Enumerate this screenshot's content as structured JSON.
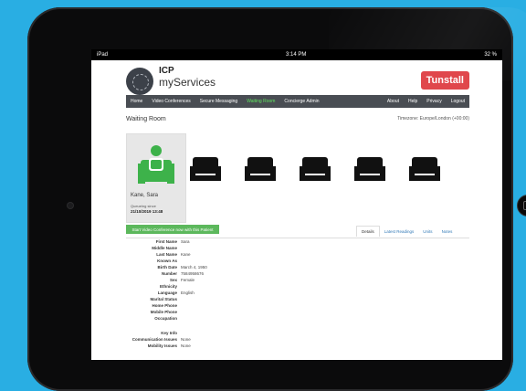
{
  "status": {
    "device": "iPad",
    "time": "3:14 PM",
    "battery": "32 %"
  },
  "app": {
    "logo_line1": "ICP",
    "logo_line2": "myServices",
    "brand": "Tunstall"
  },
  "nav": {
    "items": [
      {
        "label": "Home"
      },
      {
        "label": "Video Conferences"
      },
      {
        "label": "Secure Messaging"
      },
      {
        "label": "Waiting Room"
      },
      {
        "label": "Concierge Admin"
      }
    ],
    "right": [
      {
        "label": "About"
      },
      {
        "label": "Help"
      },
      {
        "label": "Privacy"
      },
      {
        "label": "Logout"
      }
    ]
  },
  "page": {
    "title": "Waiting Room",
    "timezone": "Timezone: Europe/London (+00:00)"
  },
  "patient": {
    "name": "Kane, Sara",
    "queue_label": "Queueing since",
    "queue_date": "21/10/2019 13:48"
  },
  "actions": {
    "start_video": "Start Video Conference now with this Patient"
  },
  "tabs": [
    {
      "label": "Details"
    },
    {
      "label": "Latest Readings"
    },
    {
      "label": "Units"
    },
    {
      "label": "Notes"
    }
  ],
  "details": [
    {
      "label": "First Name",
      "value": "Sara"
    },
    {
      "label": "Middle Name",
      "value": ""
    },
    {
      "label": "Last Name",
      "value": "Kane"
    },
    {
      "label": "Known As",
      "value": ""
    },
    {
      "label": "Birth Date",
      "value": "March 4, 1950"
    },
    {
      "label": "Number",
      "value": "7584958676"
    },
    {
      "label": "Sex",
      "value": "Female"
    },
    {
      "label": "Ethnicity",
      "value": ""
    },
    {
      "label": "Language",
      "value": "English"
    },
    {
      "label": "Marital Status",
      "value": ""
    },
    {
      "label": "Home Phone",
      "value": ""
    },
    {
      "label": "Mobile Phone",
      "value": ""
    },
    {
      "label": "Occupation",
      "value": ""
    }
  ],
  "key_info": {
    "title": "Key Info",
    "rows": [
      {
        "label": "Communication Issues",
        "value": "None"
      },
      {
        "label": "Mobility Issues",
        "value": "None"
      }
    ]
  },
  "colors": {
    "accent": "#5cb85c",
    "brand": "#e0474c",
    "nav": "#494d53"
  }
}
